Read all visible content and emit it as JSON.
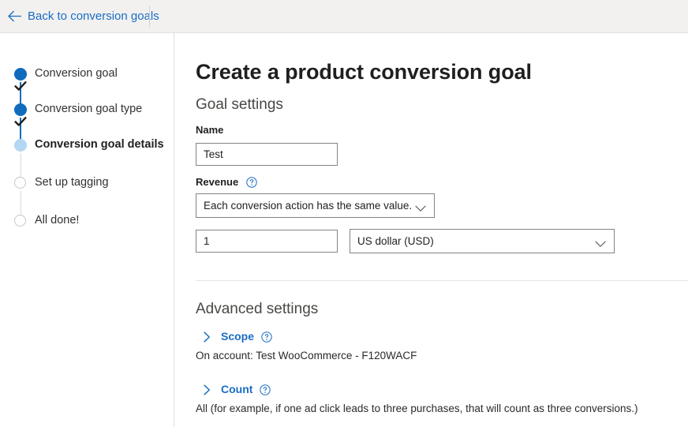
{
  "topbar": {
    "back_label": "Back to conversion goals",
    "back_icon": "arrow-left-icon"
  },
  "stepper": {
    "steps": [
      {
        "label": "Conversion goal",
        "state": "completed"
      },
      {
        "label": "Conversion goal type",
        "state": "completed"
      },
      {
        "label": "Conversion goal details",
        "state": "current"
      },
      {
        "label": "Set up tagging",
        "state": "pending"
      },
      {
        "label": "All done!",
        "state": "pending"
      }
    ]
  },
  "main": {
    "page_title": "Create a product conversion goal",
    "goal_settings": {
      "heading": "Goal settings",
      "name_label": "Name",
      "name_value": "Test",
      "revenue_label": "Revenue",
      "revenue_help_icon": "help-circle-icon",
      "revenue_select_value": "Each conversion action has the same value.",
      "value_input": "1",
      "currency_select_value": "US dollar (USD)"
    },
    "advanced_settings": {
      "heading": "Advanced settings",
      "scope": {
        "label": "Scope",
        "help_icon": "help-circle-icon",
        "chevron_icon": "chevron-right-icon",
        "description": "On account: Test WooCommerce - F120WACF"
      },
      "count": {
        "label": "Count",
        "help_icon": "help-circle-icon",
        "chevron_icon": "chevron-right-icon",
        "description": "All (for example, if one ad click leads to three purchases, that will count as three conversions.)"
      }
    }
  },
  "colors": {
    "accent_blue": "#1a6dc4",
    "step_done_blue": "#0f6cbd",
    "step_current_blue": "#b3d7f2",
    "header_bg": "#f2f1f0",
    "border_gray": "#86837f"
  }
}
